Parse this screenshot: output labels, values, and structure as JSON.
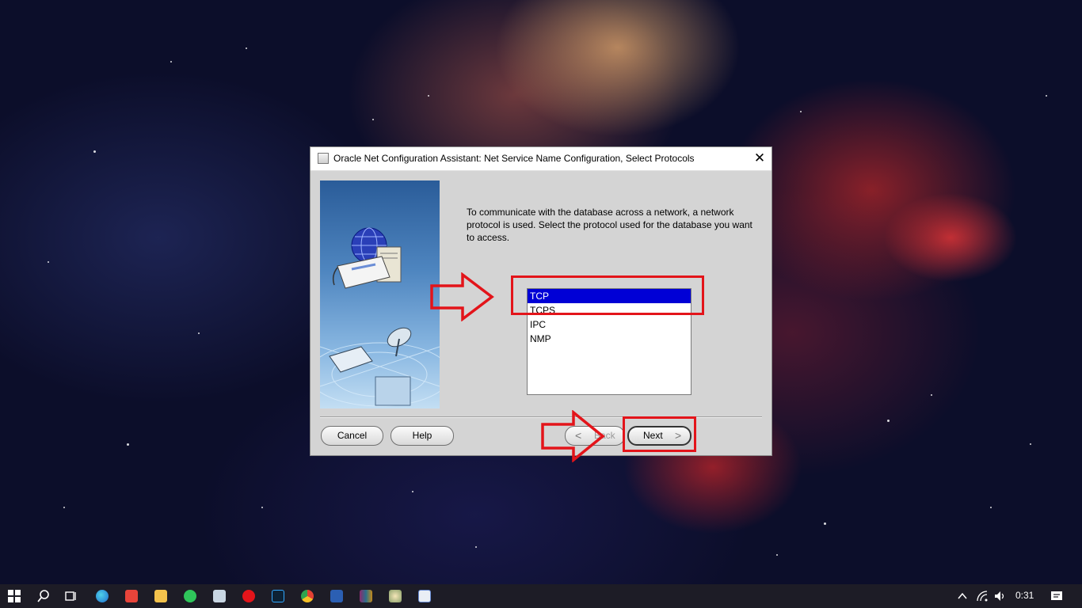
{
  "dialog": {
    "title": "Oracle Net Configuration Assistant: Net Service Name Configuration, Select Protocols",
    "close_label": "✕",
    "instructions": "To communicate with the database across a network, a network protocol is used. Select the protocol used for the database you want to access.",
    "protocols": [
      "TCP",
      "TCPS",
      "IPC",
      "NMP"
    ],
    "selected_protocol": "TCP",
    "buttons": {
      "cancel": "Cancel",
      "help": "Help",
      "back": "Back",
      "next": "Next",
      "back_chevron": "<",
      "next_chevron": ">"
    }
  },
  "taskbar": {
    "icons": [
      "windows-start-icon",
      "search-icon",
      "task-view-icon",
      "edge-icon",
      "app-icon",
      "file-explorer-icon",
      "whatsapp-icon",
      "notes-icon",
      "opera-icon",
      "photoshop-icon",
      "chrome-icon",
      "word-icon",
      "winrar-icon",
      "paint-icon",
      "app-window-icon"
    ],
    "tray_icons": [
      "chevron-up-icon",
      "wifi-icon",
      "volume-icon",
      "notification-icon"
    ],
    "time": "0:31"
  },
  "colors": {
    "selection": "#0000d6",
    "annotation_red": "#e3141a",
    "dialog_bg": "#d4d4d4",
    "taskbar_bg": "#1d1c26"
  }
}
